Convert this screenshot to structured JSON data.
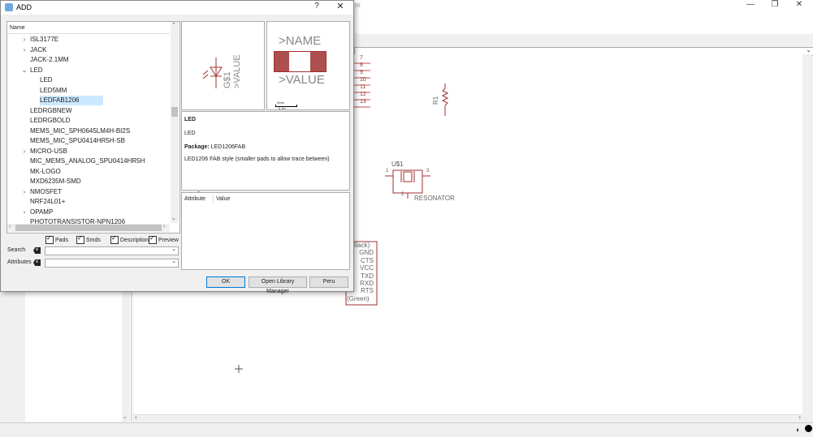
{
  "background_window": {
    "title_fragment": "m",
    "controls": {
      "minimize": "—",
      "maximize": "❐",
      "close": "✕"
    }
  },
  "schematic": {
    "pin_numbers": [
      "7",
      "8",
      "9",
      "10",
      "11",
      "12",
      "13"
    ],
    "resistor_label": "R1",
    "resonator": {
      "ref": "U$1",
      "name": "RESONATOR",
      "pin_left": "1",
      "pin_right": "3",
      "pin_bottom": "2"
    },
    "connector": {
      "top": "Black)",
      "pins": [
        "GND",
        "CTS",
        "VCC",
        "TXD",
        "RXD",
        "RTS"
      ],
      "bottom": "(Green)"
    }
  },
  "dialog": {
    "title": "ADD",
    "help": "?",
    "close": "✕",
    "tree": {
      "header": "Name",
      "rows": [
        {
          "label": "ISL3177E",
          "expander": "›",
          "indent": 0
        },
        {
          "label": "JACK",
          "expander": "›",
          "indent": 0
        },
        {
          "label": "JACK-2.1MM",
          "expander": "",
          "indent": 0
        },
        {
          "label": "LED",
          "expander": "⌄",
          "indent": 0
        },
        {
          "label": "LED",
          "expander": "",
          "indent": 1
        },
        {
          "label": "LED5MM",
          "expander": "",
          "indent": 1
        },
        {
          "label": "LEDFAB1206",
          "expander": "",
          "indent": 1,
          "selected": true
        },
        {
          "label": "LEDRGBNEW",
          "expander": "",
          "indent": 0
        },
        {
          "label": "LEDRGBOLD",
          "expander": "",
          "indent": 0
        },
        {
          "label": "MEMS_MIC_SPH0645LM4H-BI2S",
          "expander": "",
          "indent": 0
        },
        {
          "label": "MEMS_MIC_SPU0414HR5H-SB",
          "expander": "",
          "indent": 0
        },
        {
          "label": "MICRO-USB",
          "expander": "›",
          "indent": 0
        },
        {
          "label": "MIC_MEMS_ANALOG_SPU0414HR5H",
          "expander": "",
          "indent": 0
        },
        {
          "label": "MK-LOGO",
          "expander": "",
          "indent": 0
        },
        {
          "label": "MXD6235M-SMD",
          "expander": "",
          "indent": 0
        },
        {
          "label": "NMOSFET",
          "expander": "›",
          "indent": 0
        },
        {
          "label": "NRF24L01+",
          "expander": "",
          "indent": 0
        },
        {
          "label": "OPAMP",
          "expander": "›",
          "indent": 0
        },
        {
          "label": "PHOTOTRANSISTOR-NPN1206",
          "expander": "",
          "indent": 0
        }
      ]
    },
    "checkboxes": [
      {
        "label": "Pads",
        "checked": true
      },
      {
        "label": "Smds",
        "checked": true
      },
      {
        "label": "Description",
        "checked": true
      },
      {
        "label": "Preview",
        "checked": true
      }
    ],
    "search_label": "Search",
    "attributes_label": "Attributes",
    "symbol_preview": {
      "name": "G$1",
      "value": ">VALUE"
    },
    "package_preview": {
      "name": ">NAME",
      "value": ">VALUE",
      "scale": "2mm",
      "scale_sub": "0.1in"
    },
    "description": {
      "title": "LED",
      "subtitle": "LED",
      "package_label": "Package:",
      "package_value": "LED1206FAB",
      "text": "LED1206 FAB style (smaller pads to allow trace between)"
    },
    "attributes": {
      "col_attribute": "Attribute",
      "col_value": "Value"
    },
    "buttons": {
      "ok": "OK",
      "library_manager": "Open Library Manager",
      "third": "Peru"
    }
  }
}
